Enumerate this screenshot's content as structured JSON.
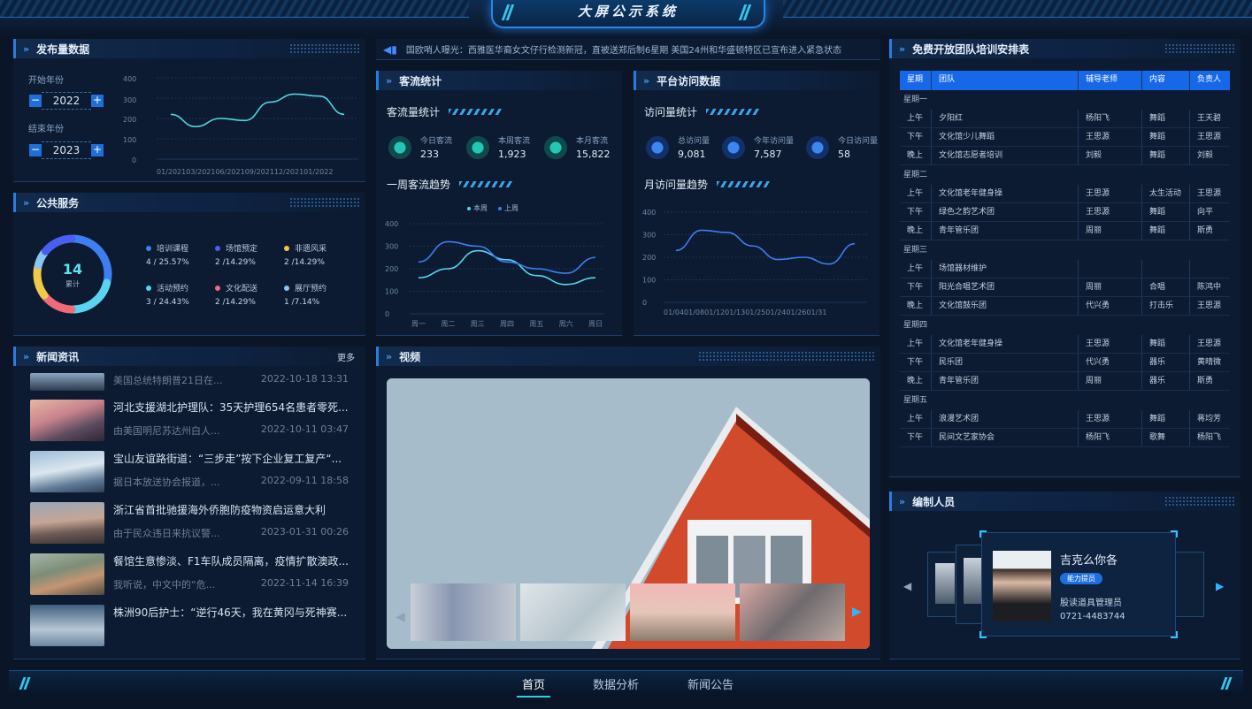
{
  "header": {
    "title": "大屏公示系统"
  },
  "release": {
    "title": "发布量数据",
    "start_label": "开始年份",
    "start_year": "2022",
    "end_label": "结束年份",
    "end_year": "2023",
    "minus": "−",
    "plus": "+",
    "y_ticks": [
      "400",
      "300",
      "200",
      "100",
      "0"
    ],
    "x_labels": "01/202103/202106/202109/202112/202101/2022"
  },
  "service": {
    "title": "公共服务",
    "total": "14",
    "total_label": "累计",
    "items": [
      {
        "label": "培训课程",
        "value": "4 / 25.57%",
        "color": "#3d7ef0"
      },
      {
        "label": "场馆预定",
        "value": "2 /14.29%",
        "color": "#4a5ff0"
      },
      {
        "label": "非遗风采",
        "value": "2 /14.29%",
        "color": "#f0c84a"
      },
      {
        "label": "活动预约",
        "value": "3 / 24.43%",
        "color": "#58d4f0"
      },
      {
        "label": "文化配送",
        "value": "2 /14.29%",
        "color": "#f06a7a"
      },
      {
        "label": "展厅预约",
        "value": "1 /7.14%",
        "color": "#8bc4f5"
      }
    ]
  },
  "news": {
    "title": "新闻资讯",
    "more": "更多",
    "items": [
      {
        "title": "美国总统特朗普21日在...",
        "sub": "",
        "time": "2022-10-18 13:31"
      },
      {
        "title": "河北支援湖北护理队：35天护理654名患者零死...",
        "sub": "由美国明尼苏达州白人...",
        "time": "2022-10-11 03:47"
      },
      {
        "title": "宝山友谊路街道：“三步走”按下企业复工复产“...",
        "sub": "据日本放送协会报道，...",
        "time": "2022-09-11 18:58"
      },
      {
        "title": "浙江省首批驰援海外侨胞防疫物资启运意大利",
        "sub": "由于民众违日来抗议警...",
        "time": "2023-01-31 00:26"
      },
      {
        "title": "餐馆生意惨淡、F1车队成员隔离，疫情扩散澳政...",
        "sub": "我听说，中文中的“危...",
        "time": "2022-11-14 16:39"
      },
      {
        "title": "株洲90后护士：“逆行46天，我在黄冈与死神赛...",
        "sub": "",
        "time": ""
      }
    ]
  },
  "ticker": {
    "text": "国欧哨人曝光：西雅医华裔女文仔行检测新冠，直被送郑后制6星期    美国24州和华盛顿特区已宣布进入紧急状态"
  },
  "visitors": {
    "title": "客流统计",
    "sub1": "客流量统计",
    "stats": [
      {
        "label": "今日客流",
        "value": "233"
      },
      {
        "label": "本周客流",
        "value": "1,923"
      },
      {
        "label": "本月客流",
        "value": "15,822"
      }
    ],
    "sub2": "一周客流趋势",
    "legend": [
      "本周",
      "上周"
    ],
    "y_ticks": [
      "400",
      "300",
      "200",
      "100",
      "0"
    ],
    "x_labels": [
      "周一",
      "周二",
      "周三",
      "周四",
      "周五",
      "周六",
      "周日"
    ]
  },
  "platform": {
    "title": "平台访问数据",
    "sub1": "访问量统计",
    "stats": [
      {
        "label": "总访问量",
        "value": "9,081"
      },
      {
        "label": "今年访问量",
        "value": "7,587"
      },
      {
        "label": "今日访问量",
        "value": "58"
      }
    ],
    "sub2": "月访问量趋势",
    "y_ticks": [
      "400",
      "300",
      "200",
      "100",
      "0"
    ],
    "x_labels": "01/0401/0801/1201/1301/2501/2401/2601/31"
  },
  "video": {
    "title": "视频"
  },
  "schedule": {
    "title": "免费开放团队培训安排表",
    "headers": [
      "星期",
      "团队",
      "辅导老师",
      "内容",
      "负责人"
    ],
    "days": [
      {
        "day": "星期一",
        "rows": [
          [
            "上午",
            "夕阳红",
            "杨阳飞",
            "舞蹈",
            "王天碧"
          ],
          [
            "下午",
            "文化馆少儿舞蹈",
            "王思源",
            "舞蹈",
            "王思源"
          ],
          [
            "晚上",
            "文化馆志愿者培训",
            "刘毅",
            "舞蹈",
            "刘毅"
          ]
        ]
      },
      {
        "day": "星期二",
        "rows": [
          [
            "上午",
            "文化馆老年健身操",
            "王思源",
            "太生活动",
            "王思源"
          ],
          [
            "下午",
            "绿色之韵艺术团",
            "王思源",
            "舞蹈",
            "向平"
          ],
          [
            "晚上",
            "青年管乐团",
            "周丽",
            "舞蹈",
            "斯勇"
          ]
        ]
      },
      {
        "day": "星期三",
        "rows": [
          [
            "上午",
            "场馆器材维护",
            "",
            "",
            ""
          ],
          [
            "下午",
            "阳光合唱艺术团",
            "周丽",
            "合唱",
            "陈鸿中"
          ],
          [
            "晚上",
            "文化馆鼓乐团",
            "代兴勇",
            "打击乐",
            "王思源"
          ]
        ]
      },
      {
        "day": "星期四",
        "rows": [
          [
            "上午",
            "文化馆老年健身操",
            "王思源",
            "舞蹈",
            "王思源"
          ],
          [
            "下午",
            "民乐团",
            "代兴勇",
            "器乐",
            "黄晴微"
          ],
          [
            "晚上",
            "青年管乐团",
            "周丽",
            "器乐",
            "斯勇"
          ]
        ]
      },
      {
        "day": "星期五",
        "rows": [
          [
            "上午",
            "浪漫艺术团",
            "王思源",
            "舞蹈",
            "蒋均芳"
          ],
          [
            "下午",
            "民间文艺家协会",
            "杨阳飞",
            "歌舞",
            "杨阳飞"
          ]
        ]
      }
    ]
  },
  "staff": {
    "title": "编制人员",
    "name": "吉克么你各",
    "tag": "能力提员",
    "role": "股读道具管理员",
    "phone": "0721-4483744"
  },
  "footer": {
    "nav": [
      "首页",
      "数据分析",
      "新闻公告"
    ]
  },
  "chart_data": [
    {
      "type": "line",
      "title": "发布量数据",
      "ylim": [
        0,
        400
      ],
      "x": [
        "01/2021",
        "03/2021",
        "06/2021",
        "09/2021",
        "12/2021",
        "01/2022"
      ],
      "series": [
        {
          "values": [
            220,
            160,
            200,
            190,
            280,
            320,
            310,
            220
          ]
        }
      ]
    },
    {
      "type": "line",
      "title": "一周客流趋势",
      "ylim": [
        0,
        400
      ],
      "categories": [
        "周一",
        "周二",
        "周三",
        "周四",
        "周五",
        "周六",
        "周日"
      ],
      "series": [
        {
          "name": "本周",
          "values": [
            160,
            200,
            280,
            240,
            170,
            130,
            160
          ]
        },
        {
          "name": "上周",
          "values": [
            230,
            320,
            300,
            230,
            200,
            180,
            250
          ]
        }
      ]
    },
    {
      "type": "line",
      "title": "月访问量趋势",
      "ylim": [
        0,
        400
      ],
      "categories": [
        "01/04",
        "01/08",
        "01/12",
        "01/13",
        "01/25",
        "01/24",
        "01/26",
        "01/31"
      ],
      "series": [
        {
          "values": [
            230,
            320,
            310,
            250,
            190,
            200,
            170,
            260
          ]
        }
      ]
    }
  ]
}
